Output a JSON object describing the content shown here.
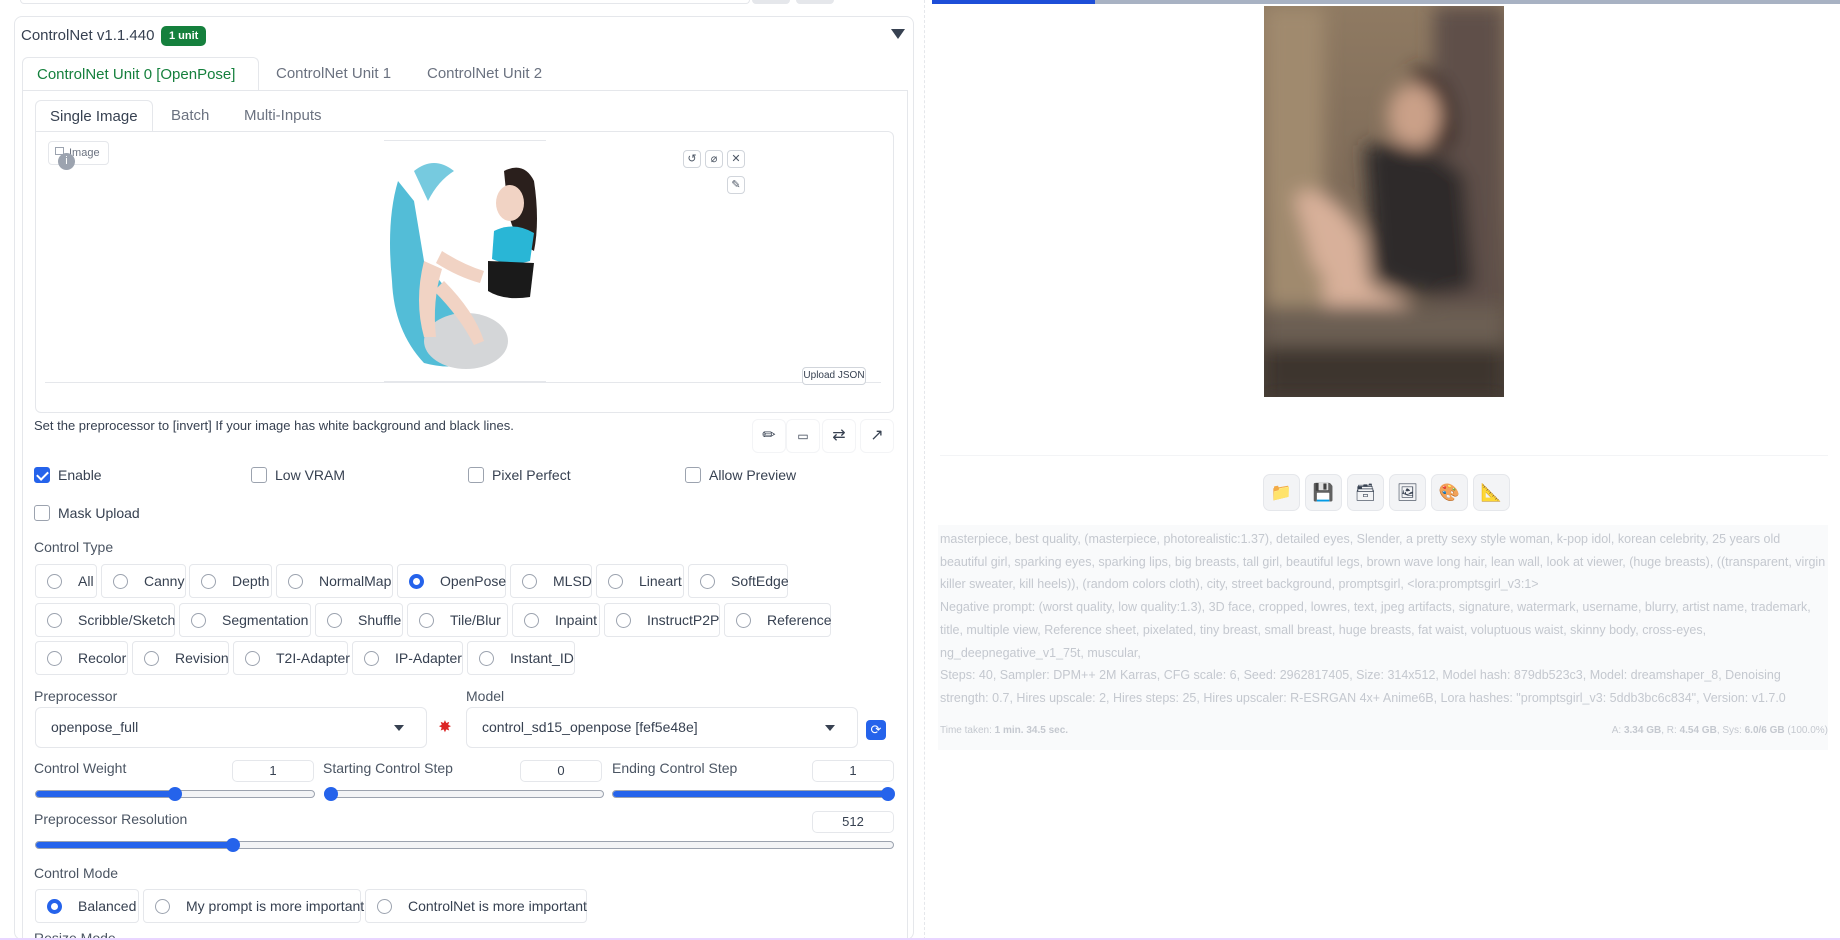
{
  "controlnet": {
    "title": "ControlNet v1.1.440",
    "badge": "1 unit",
    "unit_tabs": [
      "ControlNet Unit 0 [OpenPose]",
      "ControlNet Unit 1",
      "ControlNet Unit 2"
    ],
    "input_tabs": [
      "Single Image",
      "Batch",
      "Multi-Inputs"
    ],
    "image_label": "Image",
    "upload_json": "Upload JSON",
    "hint": "Set the preprocessor to [invert] If your image has white background and black lines.",
    "checkboxes": {
      "enable": {
        "label": "Enable",
        "checked": true
      },
      "low_vram": {
        "label": "Low VRAM",
        "checked": false
      },
      "pixel_perfect": {
        "label": "Pixel Perfect",
        "checked": false
      },
      "allow_preview": {
        "label": "Allow Preview",
        "checked": false
      },
      "mask_upload": {
        "label": "Mask Upload",
        "checked": false
      }
    },
    "control_type_label": "Control Type",
    "control_types": [
      "All",
      "Canny",
      "Depth",
      "NormalMap",
      "OpenPose",
      "MLSD",
      "Lineart",
      "SoftEdge",
      "Scribble/Sketch",
      "Segmentation",
      "Shuffle",
      "Tile/Blur",
      "Inpaint",
      "InstructP2P",
      "Reference",
      "Recolor",
      "Revision",
      "T2I-Adapter",
      "IP-Adapter",
      "Instant_ID"
    ],
    "control_type_selected": "OpenPose",
    "preprocessor_label": "Preprocessor",
    "preprocessor_value": "openpose_full",
    "model_label": "Model",
    "model_value": "control_sd15_openpose [fef5e48e]",
    "control_weight": {
      "label": "Control Weight",
      "value": "1",
      "fraction": 0.5
    },
    "starting_step": {
      "label": "Starting Control Step",
      "value": "0",
      "fraction": 0.0
    },
    "ending_step": {
      "label": "Ending Control Step",
      "value": "1",
      "fraction": 1.0
    },
    "preprocessor_resolution": {
      "label": "Preprocessor Resolution",
      "value": "512",
      "fraction": 0.23
    },
    "control_mode_label": "Control Mode",
    "control_modes": [
      "Balanced",
      "My prompt is more important",
      "ControlNet is more important"
    ],
    "control_mode_selected": "Balanced",
    "resize_mode_label": "Resize Mode"
  },
  "output": {
    "progress_fraction": 0.18,
    "buttons": [
      "folder-icon",
      "save-icon",
      "zip-icon",
      "image-icon",
      "palette-icon",
      "ruler-icon"
    ],
    "generation_info": "masterpiece, best quality, (masterpiece, photorealistic:1.37), detailed eyes, Slender, a pretty sexy style woman, k-pop idol, korean celebrity, 25 years old beautiful girl, sparking eyes, sparking lips, big breasts, tall girl, beautiful legs, brown wave long hair, lean wall, look at viewer, (huge breasts), ((transparent, virgin killer sweater, kill heels)), (random colors cloth), city, street background, promptsgirl, <lora:promptsgirl_v3:1>\nNegative prompt: (worst quality, low quality:1.3), 3D face, cropped, lowres, text, jpeg artifacts, signature, watermark, username, blurry, artist name, trademark, title, multiple view, Reference sheet, pixelated, tiny breast, small breast, huge breasts, fat waist, voluptuous waist, skinny body, cross-eyes, ng_deepnegative_v1_75t, muscular,\nSteps: 40, Sampler: DPM++ 2M Karras, CFG scale: 6, Seed: 2962817405, Size: 314x512, Model hash: 879db523c3, Model: dreamshaper_8, Denoising strength: 0.7, Hires upscale: 2, Hires steps: 25, Hires upscaler: R-ESRGAN 4x+ Anime6B, Lora hashes: \"promptsgirl_v3: 5ddb3bc6c834\", Version: v1.7.0",
    "time_taken_label": "Time taken:",
    "time_taken_value": "1 min. 34.5 sec.",
    "mem_a_label": "A:",
    "mem_a_value": "3.34 GB",
    "mem_r_label": "R:",
    "mem_r_value": "4.54 GB",
    "mem_sys_label": "Sys:",
    "mem_sys_value": "6.0/6 GB",
    "mem_sys_pct": "(100.0%)"
  }
}
